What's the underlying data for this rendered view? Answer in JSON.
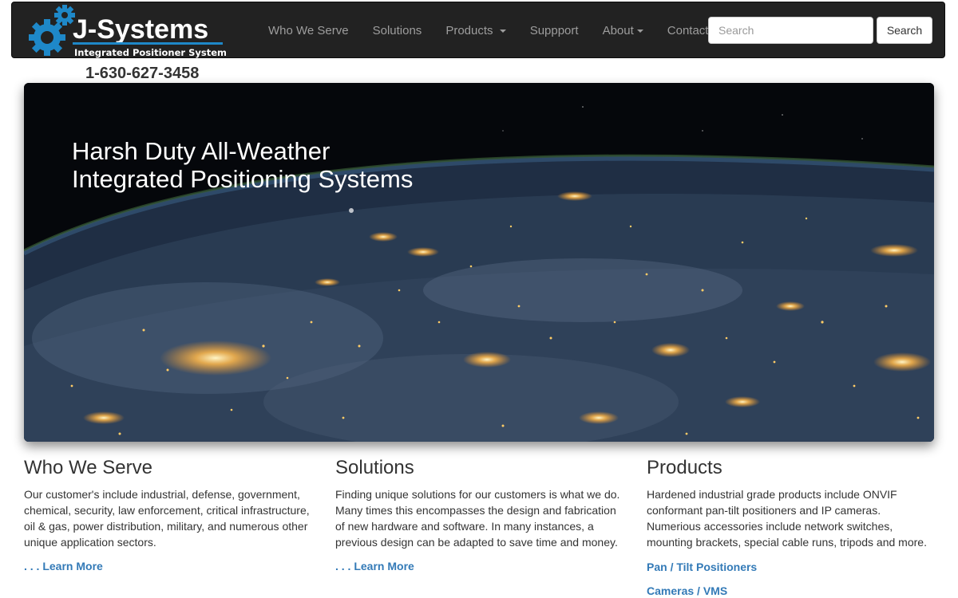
{
  "brand": {
    "name": "J-Systems",
    "tagline": "Integrated Positioner Systems",
    "accent": "#1e88c8"
  },
  "nav": {
    "items": [
      {
        "label": "Who We Serve",
        "dropdown": false
      },
      {
        "label": "Solutions",
        "dropdown": false
      },
      {
        "label": "Products",
        "dropdown": true
      },
      {
        "label": "Suppport",
        "dropdown": false
      },
      {
        "label": "About",
        "dropdown": true
      },
      {
        "label": "Contact",
        "dropdown": false
      }
    ],
    "search_placeholder": "Search",
    "search_button": "Search"
  },
  "phone": "1-630-627-3458",
  "hero": {
    "line1": "Harsh Duty All-Weather",
    "line2": "Integrated Positioning Systems"
  },
  "columns": [
    {
      "title": "Who We Serve",
      "text": "Our customer's include industrial, defense, government, chemical, security, law enforcement, critical infrastructure, oil & gas, power distribution, military, and numerous other unique application sectors.",
      "link": ". . . Learn More"
    },
    {
      "title": "Solutions",
      "text": "Finding unique solutions for our customers is what we do. Many times this encompasses the design and fabrication of new hardware and software. In many instances, a previous design can be adapted to save time and money.",
      "link": ". . . Learn More"
    },
    {
      "title": "Products",
      "text": "Hardened industrial grade products include ONVIF conformant pan-tilt positioners and IP cameras. Numerious accessories include network switches, mounting brackets, special cable runs, tripods and more.",
      "links": [
        "Pan / Tilt Positioners",
        "Cameras / VMS"
      ]
    }
  ],
  "colors": {
    "navbar_bg": "#222222",
    "nav_text": "#9d9d9d",
    "link": "#337ab7"
  }
}
